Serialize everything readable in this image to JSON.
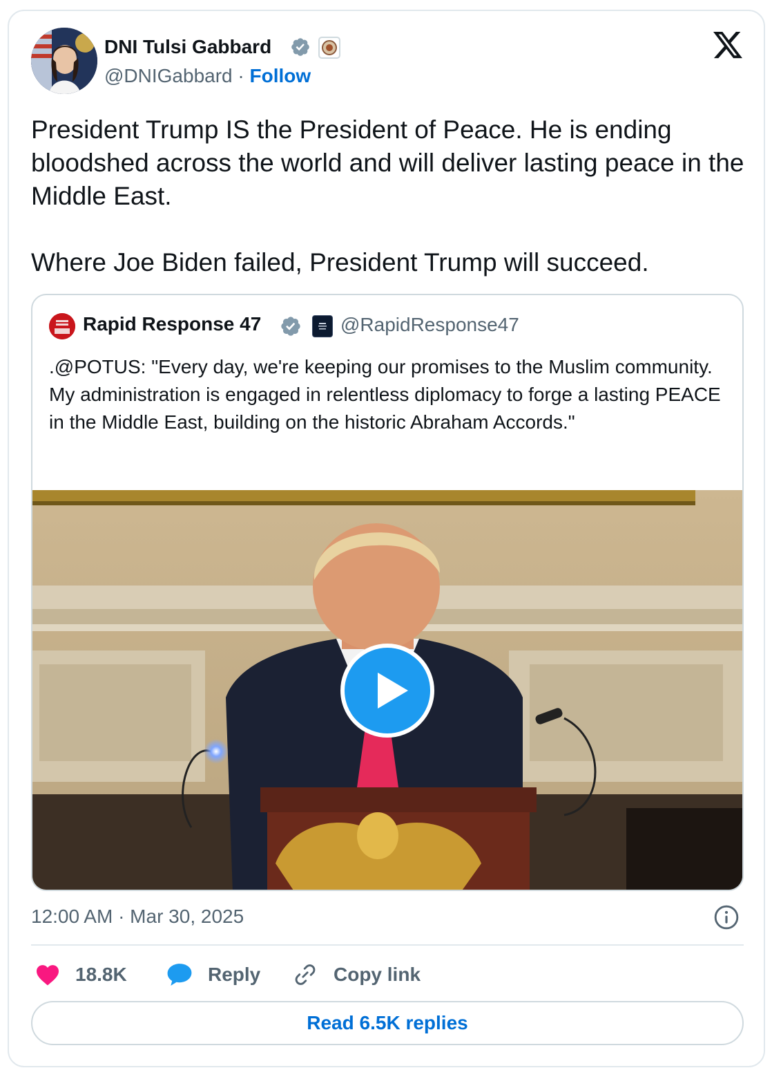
{
  "author": {
    "name": "DNI Tulsi Gabbard",
    "handle": "@DNIGabbard",
    "separator": "·",
    "follow_label": "Follow"
  },
  "tweet": {
    "paragraphs": [
      "President Trump IS the President of Peace. He is ending bloodshed across the world and will deliver lasting peace in the Middle East.",
      "Where Joe Biden failed, President Trump will succeed."
    ]
  },
  "quoted": {
    "name": "Rapid Response 47",
    "handle": "@RapidResponse47",
    "text": ".@POTUS: \"Every day, we're keeping our promises to the Muslim community. My administration is engaged in relentless diplomacy to forge a lasting PEACE in the Middle East, building on the historic Abraham Accords.\""
  },
  "meta": {
    "timestamp": "12:00 AM · Mar 30, 2025"
  },
  "actions": {
    "like_count": "18.8K",
    "reply_label": "Reply",
    "copy_link_label": "Copy link",
    "read_replies_label": "Read 6.5K replies"
  },
  "icons": {
    "like": "heart-icon",
    "reply": "speech-bubble-icon",
    "copy": "link-icon",
    "info": "info-icon",
    "brand": "x-logo-icon",
    "play": "play-icon"
  },
  "colors": {
    "link_blue": "#006fd6",
    "verified_gray": "#829aab",
    "like_pink": "#f91880",
    "reply_blue": "#1d9bf0",
    "text_secondary": "#536471"
  }
}
